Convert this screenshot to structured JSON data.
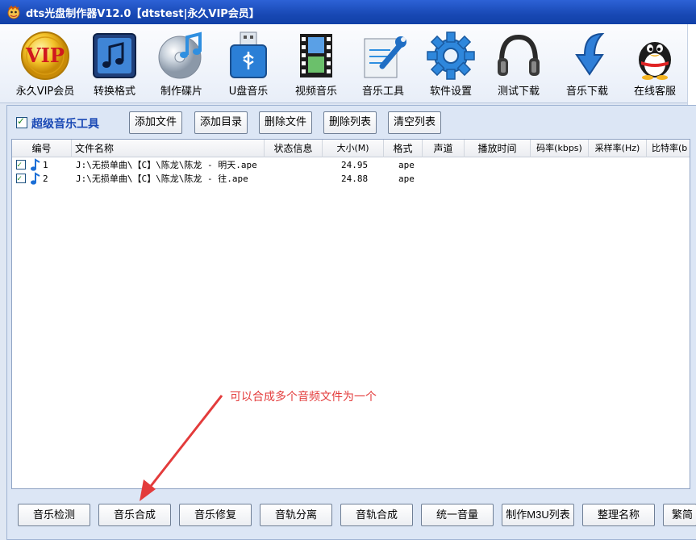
{
  "window": {
    "title": "dts光盘制作器V12.0【dtstest|永久VIP会员】"
  },
  "toolbar": {
    "items": [
      {
        "label": "永久VIP会员",
        "icon": "vip-badge-icon"
      },
      {
        "label": "转换格式",
        "icon": "music-note-icon"
      },
      {
        "label": "制作碟片",
        "icon": "disc-icon"
      },
      {
        "label": "U盘音乐",
        "icon": "usb-drive-icon"
      },
      {
        "label": "视频音乐",
        "icon": "film-strip-icon"
      },
      {
        "label": "音乐工具",
        "icon": "tools-icon"
      },
      {
        "label": "软件设置",
        "icon": "gear-icon"
      },
      {
        "label": "测试下载",
        "icon": "headphones-icon"
      },
      {
        "label": "音乐下载",
        "icon": "download-arrow-icon"
      },
      {
        "label": "在线客服",
        "icon": "penguin-icon"
      }
    ]
  },
  "panel": {
    "checked": true,
    "title": "超级音乐工具",
    "buttons": [
      "添加文件",
      "添加目录",
      "删除文件",
      "删除列表",
      "清空列表"
    ]
  },
  "table": {
    "columns": [
      "编号",
      "文件名称",
      "状态信息",
      "大小(M)",
      "格式",
      "声道",
      "播放时间",
      "码率(kbps)",
      "采样率(Hz)",
      "比特率(b"
    ],
    "rows": [
      {
        "no": "1",
        "name": "J:\\无损单曲\\【C】\\陈龙\\陈龙 - 明天.ape",
        "status": "",
        "size": "24.95",
        "format": "ape",
        "checked": true
      },
      {
        "no": "2",
        "name": "J:\\无损单曲\\【C】\\陈龙\\陈龙 - 往.ape",
        "status": "",
        "size": "24.88",
        "format": "ape",
        "checked": true
      }
    ]
  },
  "bottom": {
    "buttons": [
      "音乐检测",
      "音乐合成",
      "音乐修复",
      "音轨分离",
      "音轨合成",
      "统一音量",
      "制作M3U列表",
      "整理名称",
      "繁简"
    ]
  },
  "annotation": {
    "text": "可以合成多个音频文件为一个",
    "color": "#e33b3b"
  },
  "colors": {
    "titlebar": "#1848b4",
    "accent_text": "#1a49b5"
  }
}
